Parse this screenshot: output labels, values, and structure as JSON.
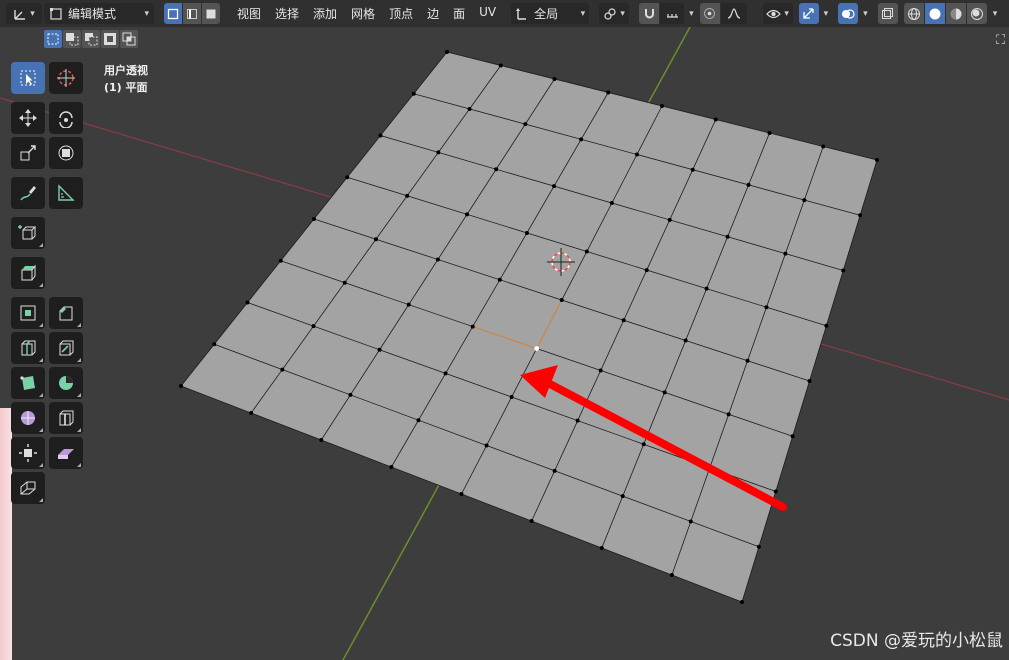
{
  "header": {
    "mode_label": "编辑模式",
    "menu": [
      "视图",
      "选择",
      "添加",
      "网格",
      "顶点",
      "边",
      "面",
      "UV"
    ],
    "transform_orientation": "全局"
  },
  "overlay": {
    "view_name": "用户透视",
    "object_name": "(1) 平面"
  },
  "watermark": "CSDN @爱玩的小松鼠",
  "colors": {
    "viewport_bg": "#3d3d3d",
    "header_bg": "#303030",
    "accent_blue": "#4772b3",
    "mesh_face": "#a3a3a3",
    "x_axis": "#8b3b45",
    "y_axis": "#6b8f2a",
    "arrow": "#ff0000",
    "selected_vertex": "#ffffff"
  },
  "toolbar": {
    "tools": [
      {
        "name": "select-box-tool",
        "icon": "cursor-box-icon",
        "active": true
      },
      {
        "name": "cursor-tool",
        "icon": "3d-cursor-icon",
        "active": false
      },
      {
        "name": "move-tool",
        "icon": "move-arrows-icon",
        "active": false
      },
      {
        "name": "rotate-tool",
        "icon": "rotate-icon",
        "active": false
      },
      {
        "name": "scale-tool",
        "icon": "scale-icon",
        "active": false
      },
      {
        "name": "transform-tool",
        "icon": "transform-icon",
        "active": false
      },
      {
        "name": "annotate-tool",
        "icon": "pencil-icon",
        "active": false
      },
      {
        "name": "measure-tool",
        "icon": "ruler-icon",
        "active": false
      },
      {
        "name": "add-cube-tool",
        "icon": "add-cube-icon",
        "active": false
      },
      {
        "name": "extrude-tool",
        "icon": "extrude-icon",
        "active": false
      },
      {
        "name": "inset-tool",
        "icon": "inset-faces-icon",
        "active": false
      },
      {
        "name": "bevel-tool",
        "icon": "bevel-icon",
        "active": false
      },
      {
        "name": "loop-cut-tool",
        "icon": "loop-cut-icon",
        "active": false
      },
      {
        "name": "knife-tool",
        "icon": "knife-icon",
        "active": false
      },
      {
        "name": "poly-build-tool",
        "icon": "poly-build-icon",
        "active": false
      },
      {
        "name": "spin-tool",
        "icon": "spin-icon",
        "active": false
      },
      {
        "name": "smooth-tool",
        "icon": "smooth-sphere-icon",
        "active": false
      },
      {
        "name": "edge-slide-tool",
        "icon": "edge-slide-icon",
        "active": false
      },
      {
        "name": "shrink-fatten-tool",
        "icon": "shrink-fatten-icon",
        "active": false
      },
      {
        "name": "shear-tool",
        "icon": "shear-icon",
        "active": false
      },
      {
        "name": "rip-region-tool",
        "icon": "rip-region-icon",
        "active": false
      }
    ]
  }
}
